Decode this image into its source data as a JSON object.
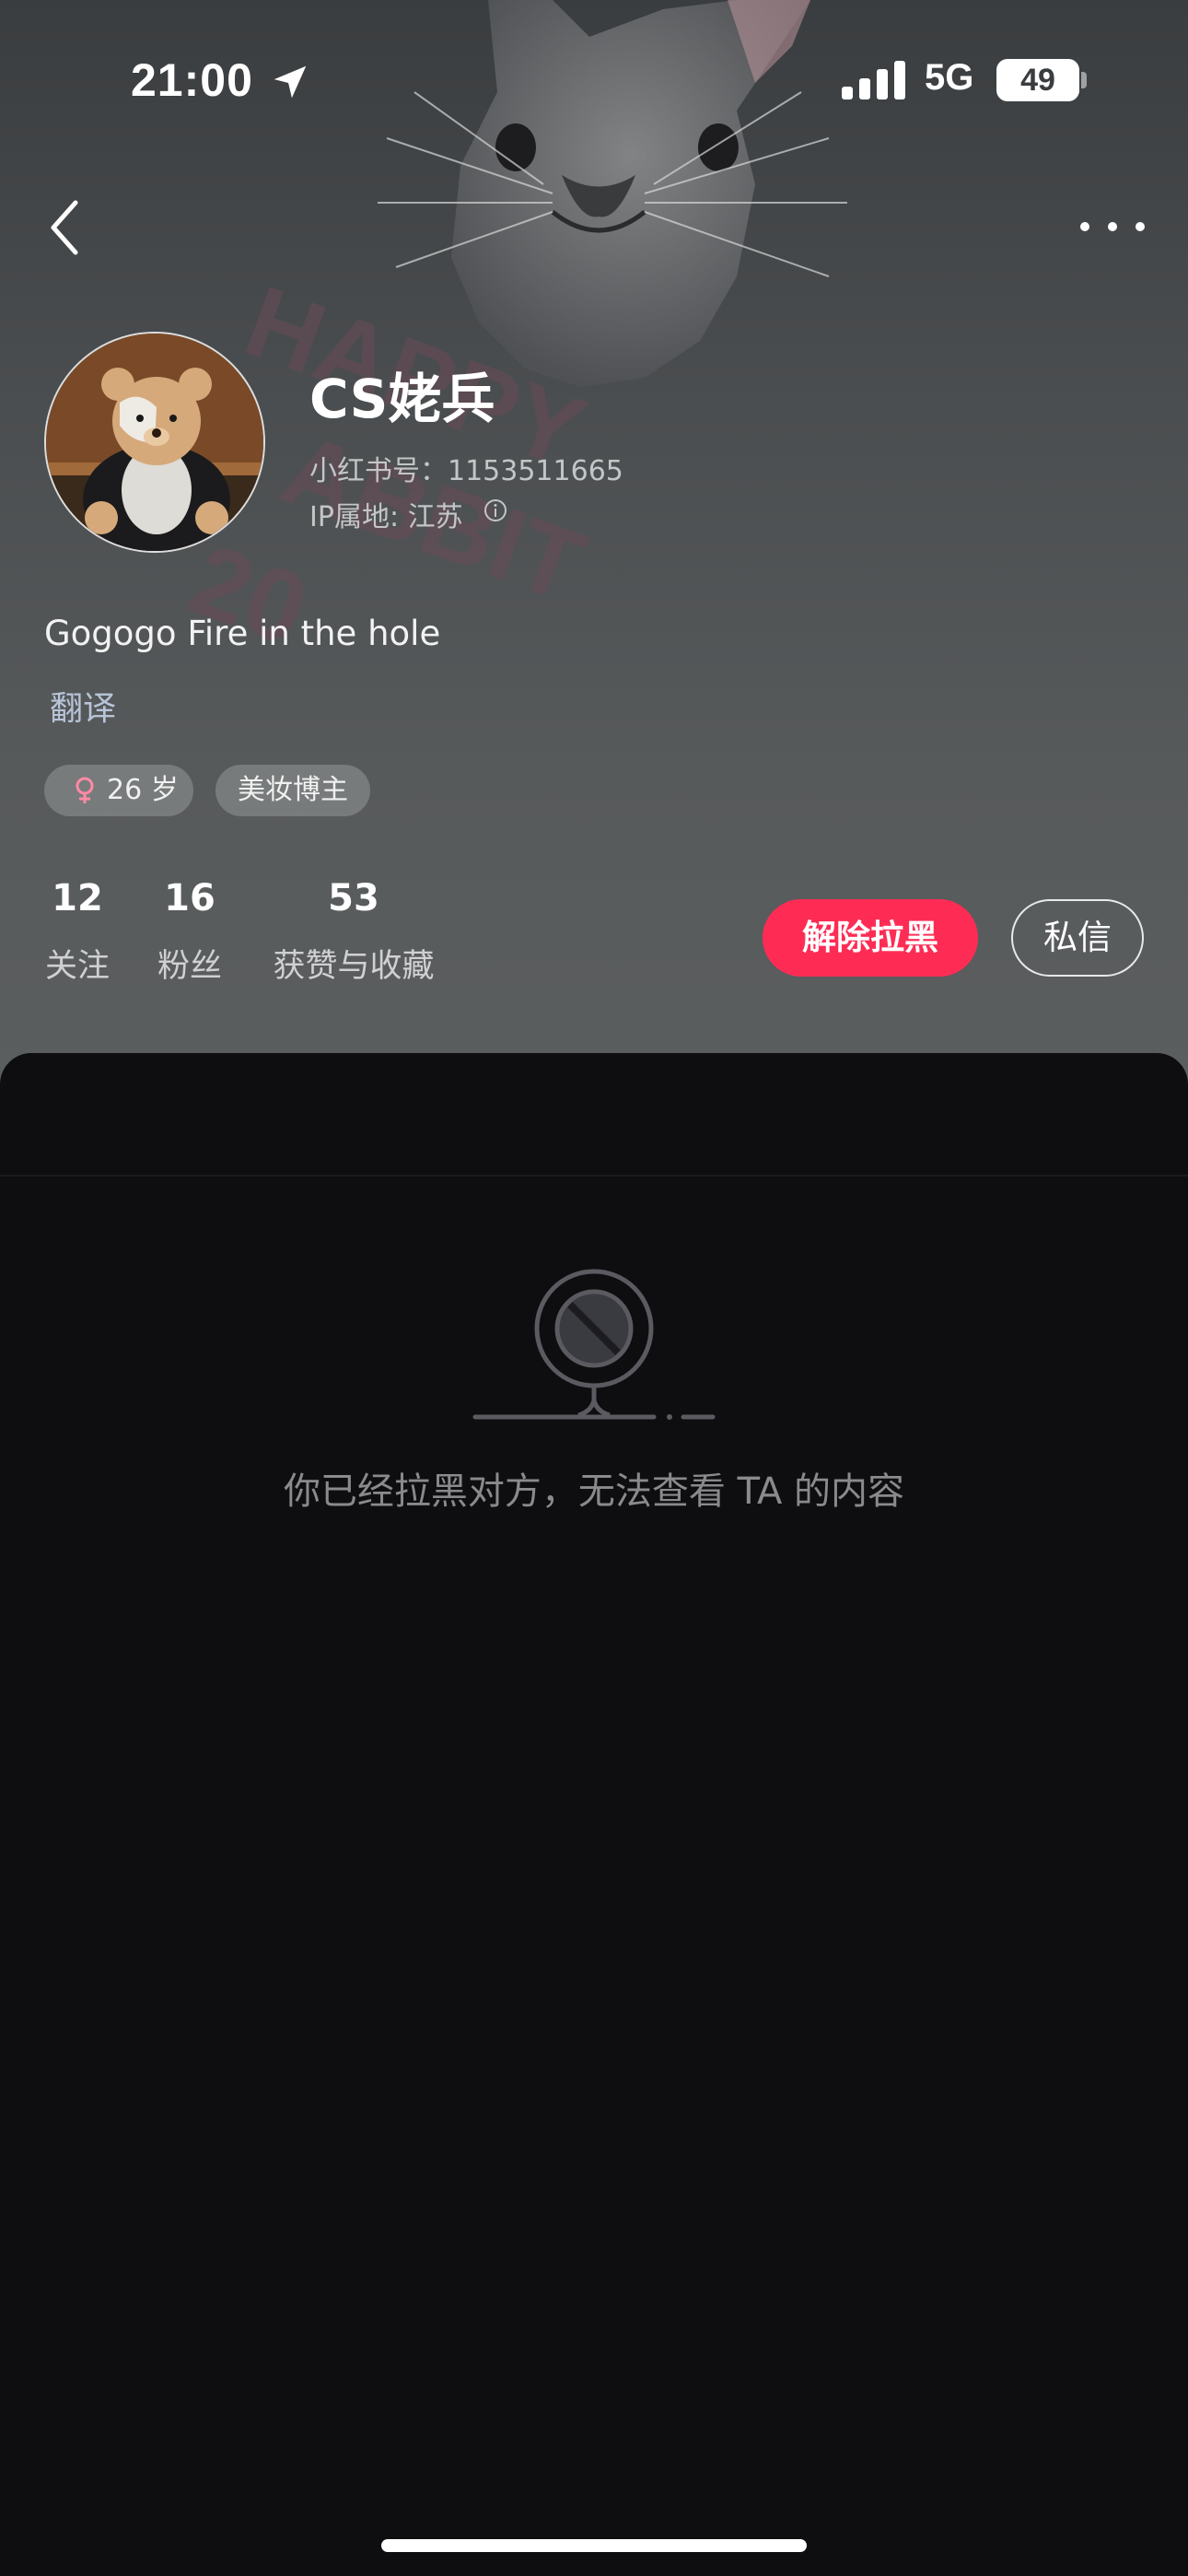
{
  "status_bar": {
    "time": "21:00",
    "network": "5G",
    "battery": "49",
    "battery_level_percent": 49
  },
  "profile": {
    "name": "CS姥兵",
    "xhs_id": "小红书号：1153511665",
    "ip_location": "IP属地: 江苏",
    "bio": "Gogogo Fire in the hole",
    "translate_label": "翻译",
    "tags": {
      "age": "26 岁",
      "category": "美妆博主"
    },
    "background_text": [
      "HAPPY",
      "ABBIT",
      "20"
    ]
  },
  "stats": {
    "following": {
      "value": "12",
      "label": "关注"
    },
    "followers": {
      "value": "16",
      "label": "粉丝"
    },
    "likes": {
      "value": "53",
      "label": "获赞与收藏"
    }
  },
  "actions": {
    "unblock": "解除拉黑",
    "message": "私信"
  },
  "empty_state": {
    "text": "你已经拉黑对方，无法查看 TA 的内容",
    "icon": "blocked-camera-icon"
  },
  "colors": {
    "accent": "#fe2c55",
    "background": "#0e0e10",
    "header": "#575a5b"
  }
}
